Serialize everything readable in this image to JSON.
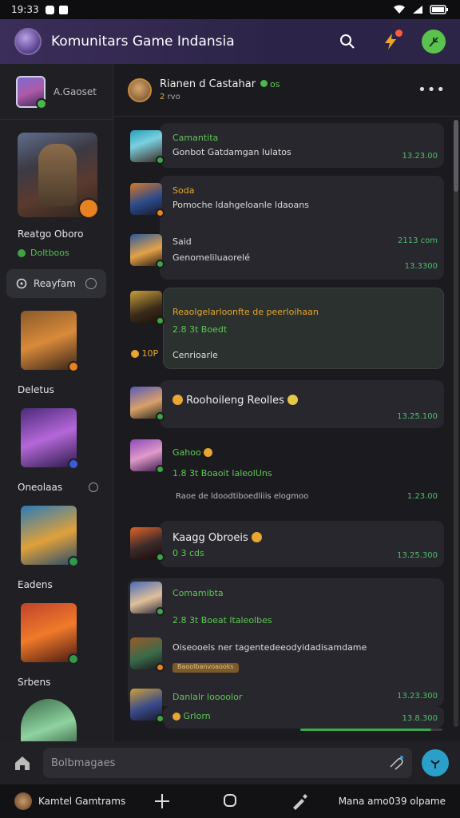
{
  "status_bar": {
    "time": "19:33"
  },
  "app": {
    "title": "Komunitars Game Indansia"
  },
  "sidebar": {
    "profile_name": "A.Gaoset",
    "hero_label": "Reatgo Oboro",
    "hero_sub": "Doltboos",
    "pill_label": "Reayfam",
    "games": [
      {
        "label": "Deletus"
      },
      {
        "label": "Oneolaas"
      },
      {
        "label": "Eadens"
      },
      {
        "label": "Srbens"
      }
    ]
  },
  "chat": {
    "title": "Rianen d Castahar",
    "title_suffix": "os",
    "sub_count": "2",
    "sub_text": "rvo"
  },
  "messages": [
    {
      "title": "Camantita",
      "text": "Gonbot Gatdamgan Iulatos",
      "time": "13.23.00"
    },
    {
      "title": "Soda",
      "text": "Pomoche ldahgeloanle ldaoans",
      "time": ""
    },
    {
      "title": "Said",
      "text": "Genomeliluaorelé",
      "time": "2113 com",
      "time2": "13.3300"
    },
    {
      "title": "Reaolgelarloonfte de peerloihaan",
      "line2": "2.8  3t  Boedt",
      "text": "Cenrioarle",
      "side_value": "10P"
    },
    {
      "title": "Roohoileng Reolles",
      "time": "13.25.100"
    },
    {
      "title": "Gahoo",
      "line2": "1.8  3t  Boaoit laleolUns",
      "text": "Raoe  de  ldoodtiboedliiis  elogmoo",
      "time": "1.23.00"
    },
    {
      "title": "Kaagg Obroeis",
      "line2": "0 3 cds",
      "time": "13.25.300"
    },
    {
      "title": "Comamibta",
      "line2": "2.8  3t  Boeat ltaleolbes",
      "text": "Oiseooels  ner  tagentedeeodyidadisamdame",
      "chip": "Baoolbanvoaooks"
    },
    {
      "title": "Danlalr loooolor",
      "line2": "Grlorn",
      "time": "13.23.300",
      "time2": "13.8.300"
    }
  ],
  "progress": {
    "value": 0.92
  },
  "composer": {
    "placeholder": "Bolbmagaes"
  },
  "navbar": {
    "left": "Kamtel Gamtrams",
    "right": "Mana amo039 olpame"
  },
  "colors": {
    "accent_green": "#5fc755",
    "accent_orange": "#e9a630",
    "appbar": "#2c2448"
  }
}
